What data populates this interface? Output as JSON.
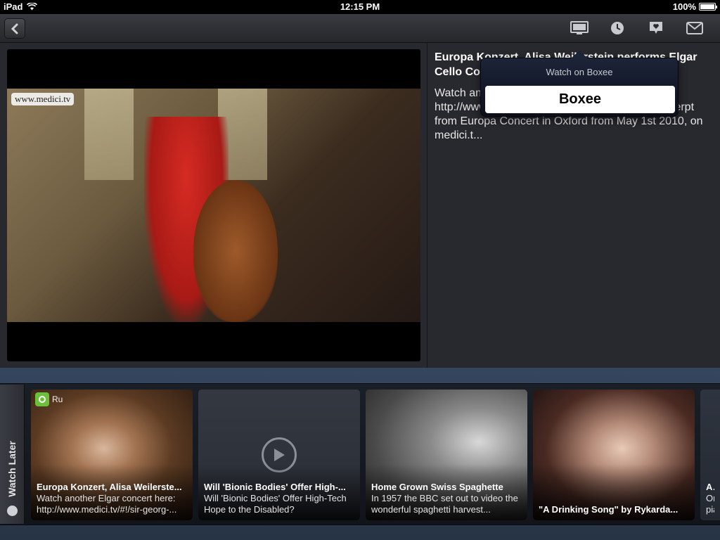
{
  "status": {
    "device": "iPad",
    "time": "12:15 PM",
    "battery": "100%",
    "battery_level": 1.0
  },
  "toolbar": {
    "back_icon": "chevron-left-icon",
    "icons": [
      "tv-icon",
      "clock-icon",
      "comment-heart-icon",
      "mail-icon"
    ]
  },
  "video": {
    "watermark": "www.medici.tv",
    "title": "Europa Konzert, Alisa Weilerstein performs Elgar Cello Concerto",
    "description": "Watch another Elgar concert here: http://www.medici.tv/#!/sir-george-solti-elgar Excerpt from Europa Concert in Oxford from May 1st 2010, on medici.t..."
  },
  "popover": {
    "title": "Watch on Boxee",
    "button": "Boxee"
  },
  "shelf": {
    "label": "Watch Later",
    "cards": [
      {
        "source": "Ru",
        "title": "Europa Konzert, Alisa Weilerste...",
        "desc": "Watch another Elgar concert here: http://www.medici.tv/#!/sir-georg-..."
      },
      {
        "title": "Will 'Bionic Bodies' Offer High-...",
        "desc": "Will 'Bionic Bodies' Offer High-Tech Hope to the Disabled?"
      },
      {
        "title": "Home Grown Swiss Spaghette",
        "desc": "In 1957 the BBC set out to video the wonderful spaghetti harvest..."
      },
      {
        "title": "\"A Drinking Song\" by Rykarda..."
      },
      {
        "title": "AN",
        "desc": "One pia"
      }
    ]
  },
  "colors": {
    "toolbar": "#2f3035",
    "popover": "#141a2a",
    "shelf": "#2f3f55",
    "badge": "#6bbf3a"
  }
}
